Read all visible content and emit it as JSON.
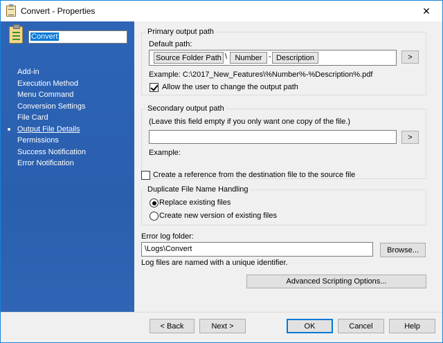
{
  "window": {
    "title": "Convert - Properties",
    "close_glyph": "✕"
  },
  "sidebar": {
    "name": "Convert",
    "items": [
      {
        "label": "Add-in",
        "selected": false
      },
      {
        "label": "Execution Method",
        "selected": false
      },
      {
        "label": "Menu Command",
        "selected": false
      },
      {
        "label": "Conversion Settings",
        "selected": false
      },
      {
        "label": "File Card",
        "selected": false
      },
      {
        "label": "Output File Details",
        "selected": true
      },
      {
        "label": "Permissions",
        "selected": false
      },
      {
        "label": "Success Notification",
        "selected": false
      },
      {
        "label": "Error Notification",
        "selected": false
      }
    ]
  },
  "primary": {
    "legend": "Primary output path",
    "default_path_label": "Default path:",
    "tokens": [
      "Source Folder Path",
      "Number",
      "Description"
    ],
    "separators": [
      "\\",
      "-"
    ],
    "browse_label": ">",
    "example": "Example: C:\\2017_New_Features\\%Number%-%Description%.pdf",
    "allow_change_label": "Allow the user to change the output path",
    "allow_change_checked": true
  },
  "secondary": {
    "legend": "Secondary output path",
    "hint": "(Leave this field empty if you only want one copy of the file.)",
    "value": "",
    "browse_label": ">",
    "example_label": "Example:"
  },
  "reference": {
    "label": "Create a reference from the destination file to the source file",
    "checked": false
  },
  "duplicate": {
    "legend": "Duplicate File Name Handling",
    "options": [
      {
        "label": "Replace existing files",
        "checked": true
      },
      {
        "label": "Create new version of existing files",
        "checked": false
      }
    ]
  },
  "error_log": {
    "label": "Error log folder:",
    "value": "\\Logs\\Convert",
    "browse_label": "Browse...",
    "note": "Log files are named with a unique identifier."
  },
  "advanced_label": "Advanced Scripting Options...",
  "footer": {
    "back": "< Back",
    "next": "Next >",
    "ok": "OK",
    "cancel": "Cancel",
    "help": "Help"
  }
}
